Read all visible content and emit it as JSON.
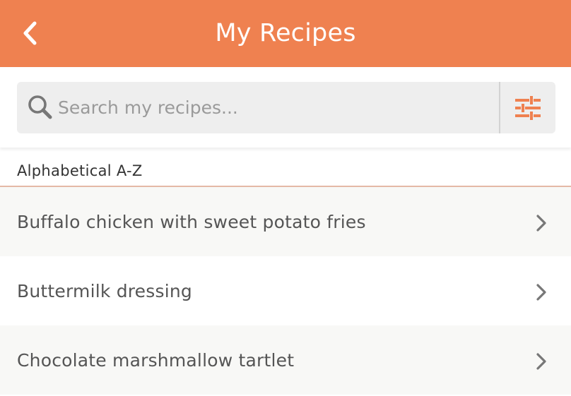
{
  "header": {
    "title": "My Recipes",
    "back_icon": "chevron-left-icon",
    "background_color": "#ef8150"
  },
  "search": {
    "value": "",
    "placeholder": "Search my recipes...",
    "search_icon": "search-icon",
    "filter_icon": "sliders-icon",
    "accent_color": "#ef8150"
  },
  "section": {
    "label": "Alphabetical A-Z"
  },
  "recipes": [
    {
      "label": "Buffalo chicken with sweet potato fries"
    },
    {
      "label": "Buttermilk dressing"
    },
    {
      "label": "Chocolate marshmallow tartlet"
    }
  ],
  "chevron_icon": "chevron-right-icon"
}
